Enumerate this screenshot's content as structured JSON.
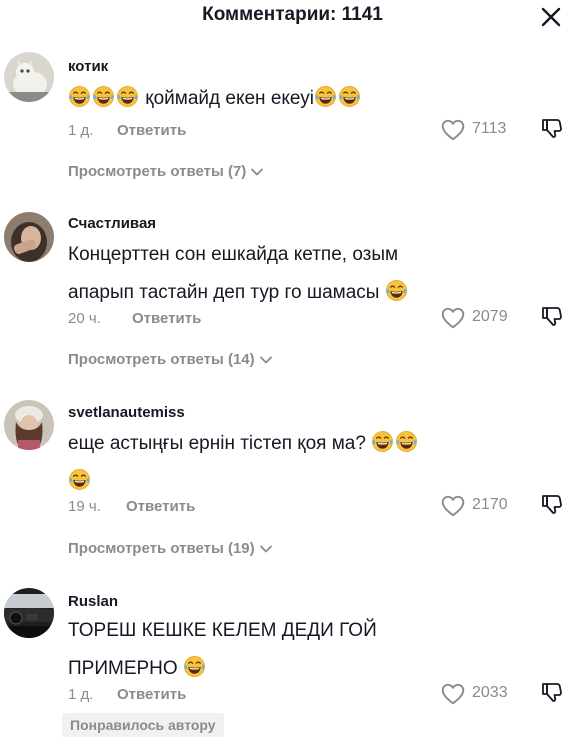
{
  "header": {
    "title": "Комментарии: 1141"
  },
  "comments": [
    {
      "username": "котик",
      "text_before": "",
      "text_main": "қоймайд екен екеуі",
      "time": "1 д.",
      "reply_label": "Ответить",
      "likes": "7113",
      "view_replies": "Просмотреть ответы (7)"
    },
    {
      "username": "Счастливая",
      "line1": "Концерттен сон ешкайда кетпе, озым",
      "line2": "апарып тастайн деп тур го шамасы",
      "time": "20 ч.",
      "reply_label": "Ответить",
      "likes": "2079",
      "view_replies": "Просмотреть ответы (14)"
    },
    {
      "username": "svetlanautemiss",
      "line1": "еще астыңғы ернін тістеп қоя ма?",
      "time": "19 ч.",
      "reply_label": "Ответить",
      "likes": "2170",
      "view_replies": "Просмотреть ответы (19)"
    },
    {
      "username": "Ruslan",
      "line1": "ТОРЕШ КЕШКЕ КЕЛЕМ ДЕДИ ГОЙ",
      "line2": "ПРИМЕРНО",
      "time": "1 д.",
      "reply_label": "Ответить",
      "likes": "2033",
      "liked_by_author": "Понравилось автору"
    }
  ],
  "colors": {
    "text": "#161823",
    "muted": "#8a8b91",
    "emoji": "#f8c33c"
  },
  "icons": [
    "close-icon",
    "heart-icon",
    "dislike-icon",
    "chevron-down-icon",
    "laughing-tears-emoji"
  ]
}
